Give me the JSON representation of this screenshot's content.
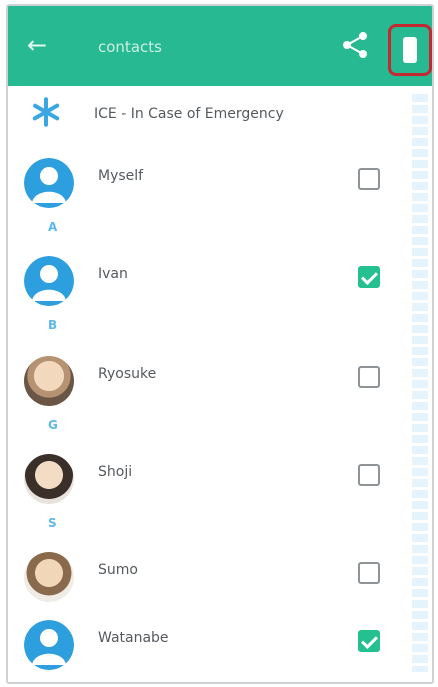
{
  "appbar": {
    "back_icon": "arrow-left-icon",
    "title": "contacts",
    "share_icon": "share-icon",
    "menu_icon": "more-vert-icon",
    "highlight_color": "#c62832",
    "bar_color": "#26b992"
  },
  "ice": {
    "label": "ICE - In Case of Emergency",
    "icon": "asterisk-star-icon"
  },
  "contacts": [
    {
      "name": "Myself",
      "checked": false
    },
    {
      "name": "Ivan",
      "checked": true
    },
    {
      "name": "Ryosuke",
      "checked": false
    },
    {
      "name": "Shoji",
      "checked": false
    },
    {
      "name": "Sumo",
      "checked": false
    },
    {
      "name": "Watanabe",
      "checked": true
    }
  ],
  "sections": [
    "A",
    "B",
    "G",
    "S"
  ]
}
